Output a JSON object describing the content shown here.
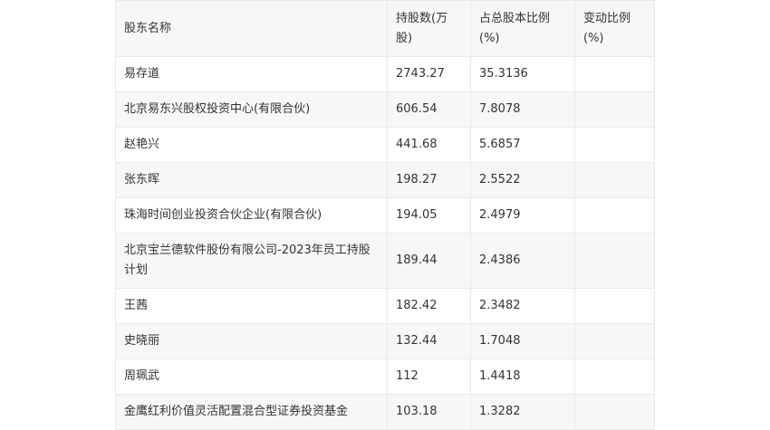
{
  "table": {
    "headers": [
      "股东名称",
      "持股数(万股)",
      "占总股本比例(%)",
      "变动比例(%)"
    ],
    "rows": [
      {
        "name": "易存道",
        "shares": "2743.27",
        "ratio": "35.3136",
        "change": ""
      },
      {
        "name": "北京易东兴股权投资中心(有限合伙)",
        "shares": "606.54",
        "ratio": "7.8078",
        "change": ""
      },
      {
        "name": "赵艳兴",
        "shares": "441.68",
        "ratio": "5.6857",
        "change": ""
      },
      {
        "name": "张东晖",
        "shares": "198.27",
        "ratio": "2.5522",
        "change": ""
      },
      {
        "name": "珠海时间创业投资合伙企业(有限合伙)",
        "shares": "194.05",
        "ratio": "2.4979",
        "change": ""
      },
      {
        "name": "北京宝兰德软件股份有限公司-2023年员工持股计划",
        "shares": "189.44",
        "ratio": "2.4386",
        "change": ""
      },
      {
        "name": "王茜",
        "shares": "182.42",
        "ratio": "2.3482",
        "change": ""
      },
      {
        "name": "史晓丽",
        "shares": "132.44",
        "ratio": "1.7048",
        "change": ""
      },
      {
        "name": "周珮武",
        "shares": "112",
        "ratio": "1.4418",
        "change": ""
      },
      {
        "name": "金鹰红利价值灵活配置混合型证券投资基金",
        "shares": "103.18",
        "ratio": "1.3282",
        "change": ""
      }
    ]
  }
}
